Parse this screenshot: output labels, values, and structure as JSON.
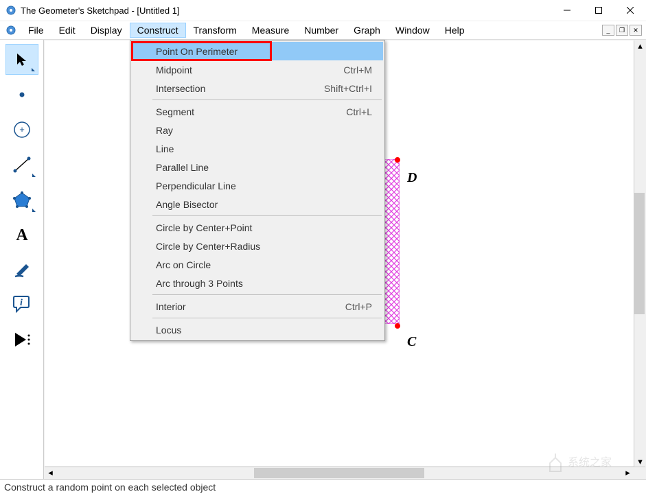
{
  "title": "The Geometer's Sketchpad - [Untitled 1]",
  "menus": [
    "File",
    "Edit",
    "Display",
    "Construct",
    "Transform",
    "Measure",
    "Number",
    "Graph",
    "Window",
    "Help"
  ],
  "active_menu": "Construct",
  "dropdown": {
    "groups": [
      [
        {
          "label": "Point On Perimeter",
          "shortcut": "",
          "highlighted": true
        },
        {
          "label": "Midpoint",
          "shortcut": "Ctrl+M"
        },
        {
          "label": "Intersection",
          "shortcut": "Shift+Ctrl+I"
        }
      ],
      [
        {
          "label": "Segment",
          "shortcut": "Ctrl+L"
        },
        {
          "label": "Ray",
          "shortcut": ""
        },
        {
          "label": "Line",
          "shortcut": ""
        },
        {
          "label": "Parallel Line",
          "shortcut": ""
        },
        {
          "label": "Perpendicular Line",
          "shortcut": ""
        },
        {
          "label": "Angle Bisector",
          "shortcut": ""
        }
      ],
      [
        {
          "label": "Circle by Center+Point",
          "shortcut": ""
        },
        {
          "label": "Circle by Center+Radius",
          "shortcut": ""
        },
        {
          "label": "Arc on Circle",
          "shortcut": ""
        },
        {
          "label": "Arc through 3 Points",
          "shortcut": ""
        }
      ],
      [
        {
          "label": "Interior",
          "shortcut": "Ctrl+P"
        }
      ],
      [
        {
          "label": "Locus",
          "shortcut": ""
        }
      ]
    ]
  },
  "tools": [
    {
      "name": "arrow",
      "selected": true,
      "flyout": true
    },
    {
      "name": "point",
      "selected": false,
      "flyout": false
    },
    {
      "name": "compass",
      "selected": false,
      "flyout": false
    },
    {
      "name": "straightedge",
      "selected": false,
      "flyout": true
    },
    {
      "name": "polygon",
      "selected": false,
      "flyout": true
    },
    {
      "name": "text",
      "selected": false,
      "flyout": false
    },
    {
      "name": "marker",
      "selected": false,
      "flyout": false
    },
    {
      "name": "info",
      "selected": false,
      "flyout": false
    },
    {
      "name": "custom",
      "selected": false,
      "flyout": true
    }
  ],
  "points": {
    "D": "D",
    "C": "C"
  },
  "statusbar": "Construct a random point on each selected object",
  "watermark": "系统之家",
  "colors": {
    "highlight": "#91c9f7",
    "red": "#ff0000",
    "magenta": "#e040e0"
  }
}
